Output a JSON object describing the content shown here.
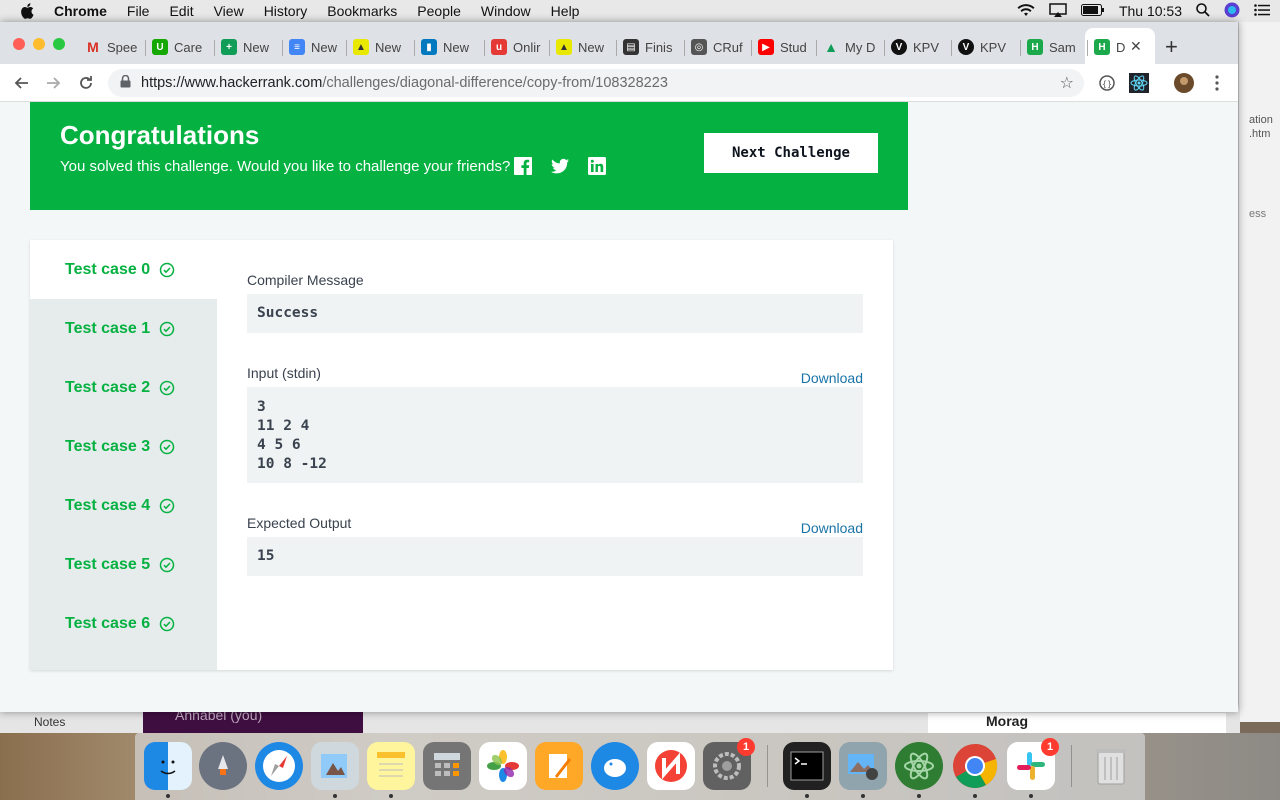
{
  "menubar": {
    "app_name": "Chrome",
    "items": [
      "File",
      "Edit",
      "View",
      "History",
      "Bookmarks",
      "People",
      "Window",
      "Help"
    ],
    "clock": "Thu 10:53"
  },
  "tabs": [
    {
      "label": "Spee",
      "icon": "gmail-icon",
      "color": "#ffffff"
    },
    {
      "label": "Care",
      "icon": "upwork-icon",
      "color": "#14a800"
    },
    {
      "label": "New",
      "icon": "sheets-icon",
      "color": "#0f9d58"
    },
    {
      "label": "New",
      "icon": "docs-icon",
      "color": "#4285f4"
    },
    {
      "label": "New",
      "icon": "triangle-icon",
      "color": "#e8e800"
    },
    {
      "label": "New",
      "icon": "trello-icon",
      "color": "#0079bf"
    },
    {
      "label": "Onlir",
      "icon": "u-icon",
      "color": "#e53935"
    },
    {
      "label": "New",
      "icon": "triangle-icon",
      "color": "#e8e800"
    },
    {
      "label": "Finis",
      "icon": "doc-icon",
      "color": "#333333"
    },
    {
      "label": "CRuf",
      "icon": "globe-icon",
      "color": "#555555"
    },
    {
      "label": "Stud",
      "icon": "youtube-icon",
      "color": "#ff0000"
    },
    {
      "label": "My D",
      "icon": "drive-icon",
      "color": "#fbbc04"
    },
    {
      "label": "KPV",
      "icon": "v-icon",
      "color": "#111111"
    },
    {
      "label": "KPV",
      "icon": "v-icon",
      "color": "#111111"
    },
    {
      "label": "Sam",
      "icon": "hackerrank-icon",
      "color": "#1ba94c"
    },
    {
      "label": "D",
      "icon": "hackerrank-icon",
      "color": "#1ba94c"
    }
  ],
  "toolbar": {
    "url_host": "https://www.hackerrank.com",
    "url_path": "/challenges/diagonal-difference/copy-from/108328223"
  },
  "banner": {
    "title": "Congratulations",
    "subtitle": "You solved this challenge. Would you like to challenge your friends?",
    "next_button": "Next Challenge",
    "color": "#05b141"
  },
  "test_cases": [
    {
      "label": "Test case 0",
      "active": true
    },
    {
      "label": "Test case 1",
      "active": false
    },
    {
      "label": "Test case 2",
      "active": false
    },
    {
      "label": "Test case 3",
      "active": false
    },
    {
      "label": "Test case 4",
      "active": false
    },
    {
      "label": "Test case 5",
      "active": false
    },
    {
      "label": "Test case 6",
      "active": false
    }
  ],
  "detail": {
    "compiler_label": "Compiler Message",
    "compiler_message": "Success",
    "input_label": "Input (stdin)",
    "input_download": "Download",
    "input_value": "3\n11 2 4\n4 5 6\n10 8 -12",
    "output_label": "Expected Output",
    "output_download": "Download",
    "output_value": "15"
  },
  "background": {
    "notes_label": "Notes",
    "slack_user": "Annabel (you)",
    "morag_label": "Morag",
    "frag_ation": "ation",
    "frag_htm": ".htm",
    "frag_ess": "ess"
  },
  "dock": {
    "apps": [
      "finder",
      "launchpad",
      "safari",
      "preview-eagle",
      "notes",
      "calculator",
      "photos",
      "pages",
      "tableplus",
      "news",
      "system-preferences",
      "terminal",
      "image-capture",
      "atom",
      "chrome",
      "slack",
      "trash"
    ],
    "badges": {
      "system-preferences": "1",
      "slack": "1"
    }
  }
}
